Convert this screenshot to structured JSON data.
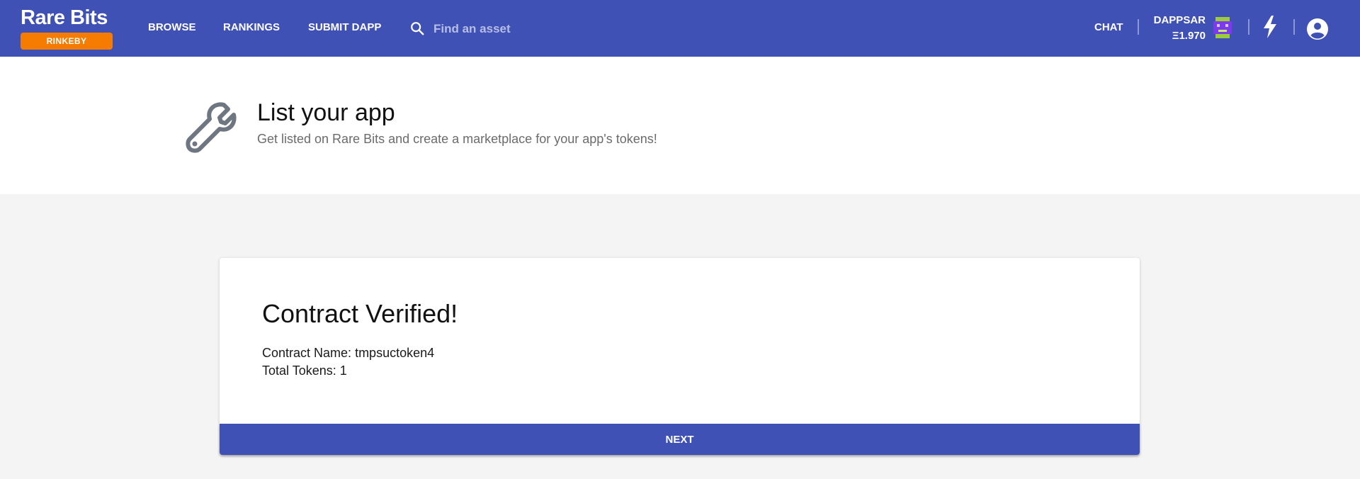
{
  "header": {
    "brand": "Rare Bits",
    "network": "RINKEBY",
    "nav": {
      "browse": "BROWSE",
      "rankings": "RANKINGS",
      "submit_dapp": "SUBMIT DAPP",
      "chat": "CHAT"
    },
    "search": {
      "placeholder": "Find an asset",
      "value": ""
    },
    "user": {
      "name": "DAPPSAR",
      "balance": "Ξ1.970"
    },
    "icons": [
      "search-icon",
      "avatar",
      "bolt-icon",
      "account-circle-icon"
    ]
  },
  "page_header": {
    "icon": "wrench-icon",
    "title": "List your app",
    "subtitle": "Get listed on Rare Bits and create a marketplace for your app's tokens!"
  },
  "card": {
    "title": "Contract Verified!",
    "contract_name_label": "Contract Name:",
    "contract_name": "tmpsuctoken4",
    "total_tokens_label": "Total Tokens:",
    "total_tokens": "1",
    "next_label": "NEXT"
  },
  "colors": {
    "primary": "#3f51b5",
    "network_badge": "#f57c00",
    "page_background": "#f4f4f4",
    "icon_gray": "#6e7781"
  }
}
